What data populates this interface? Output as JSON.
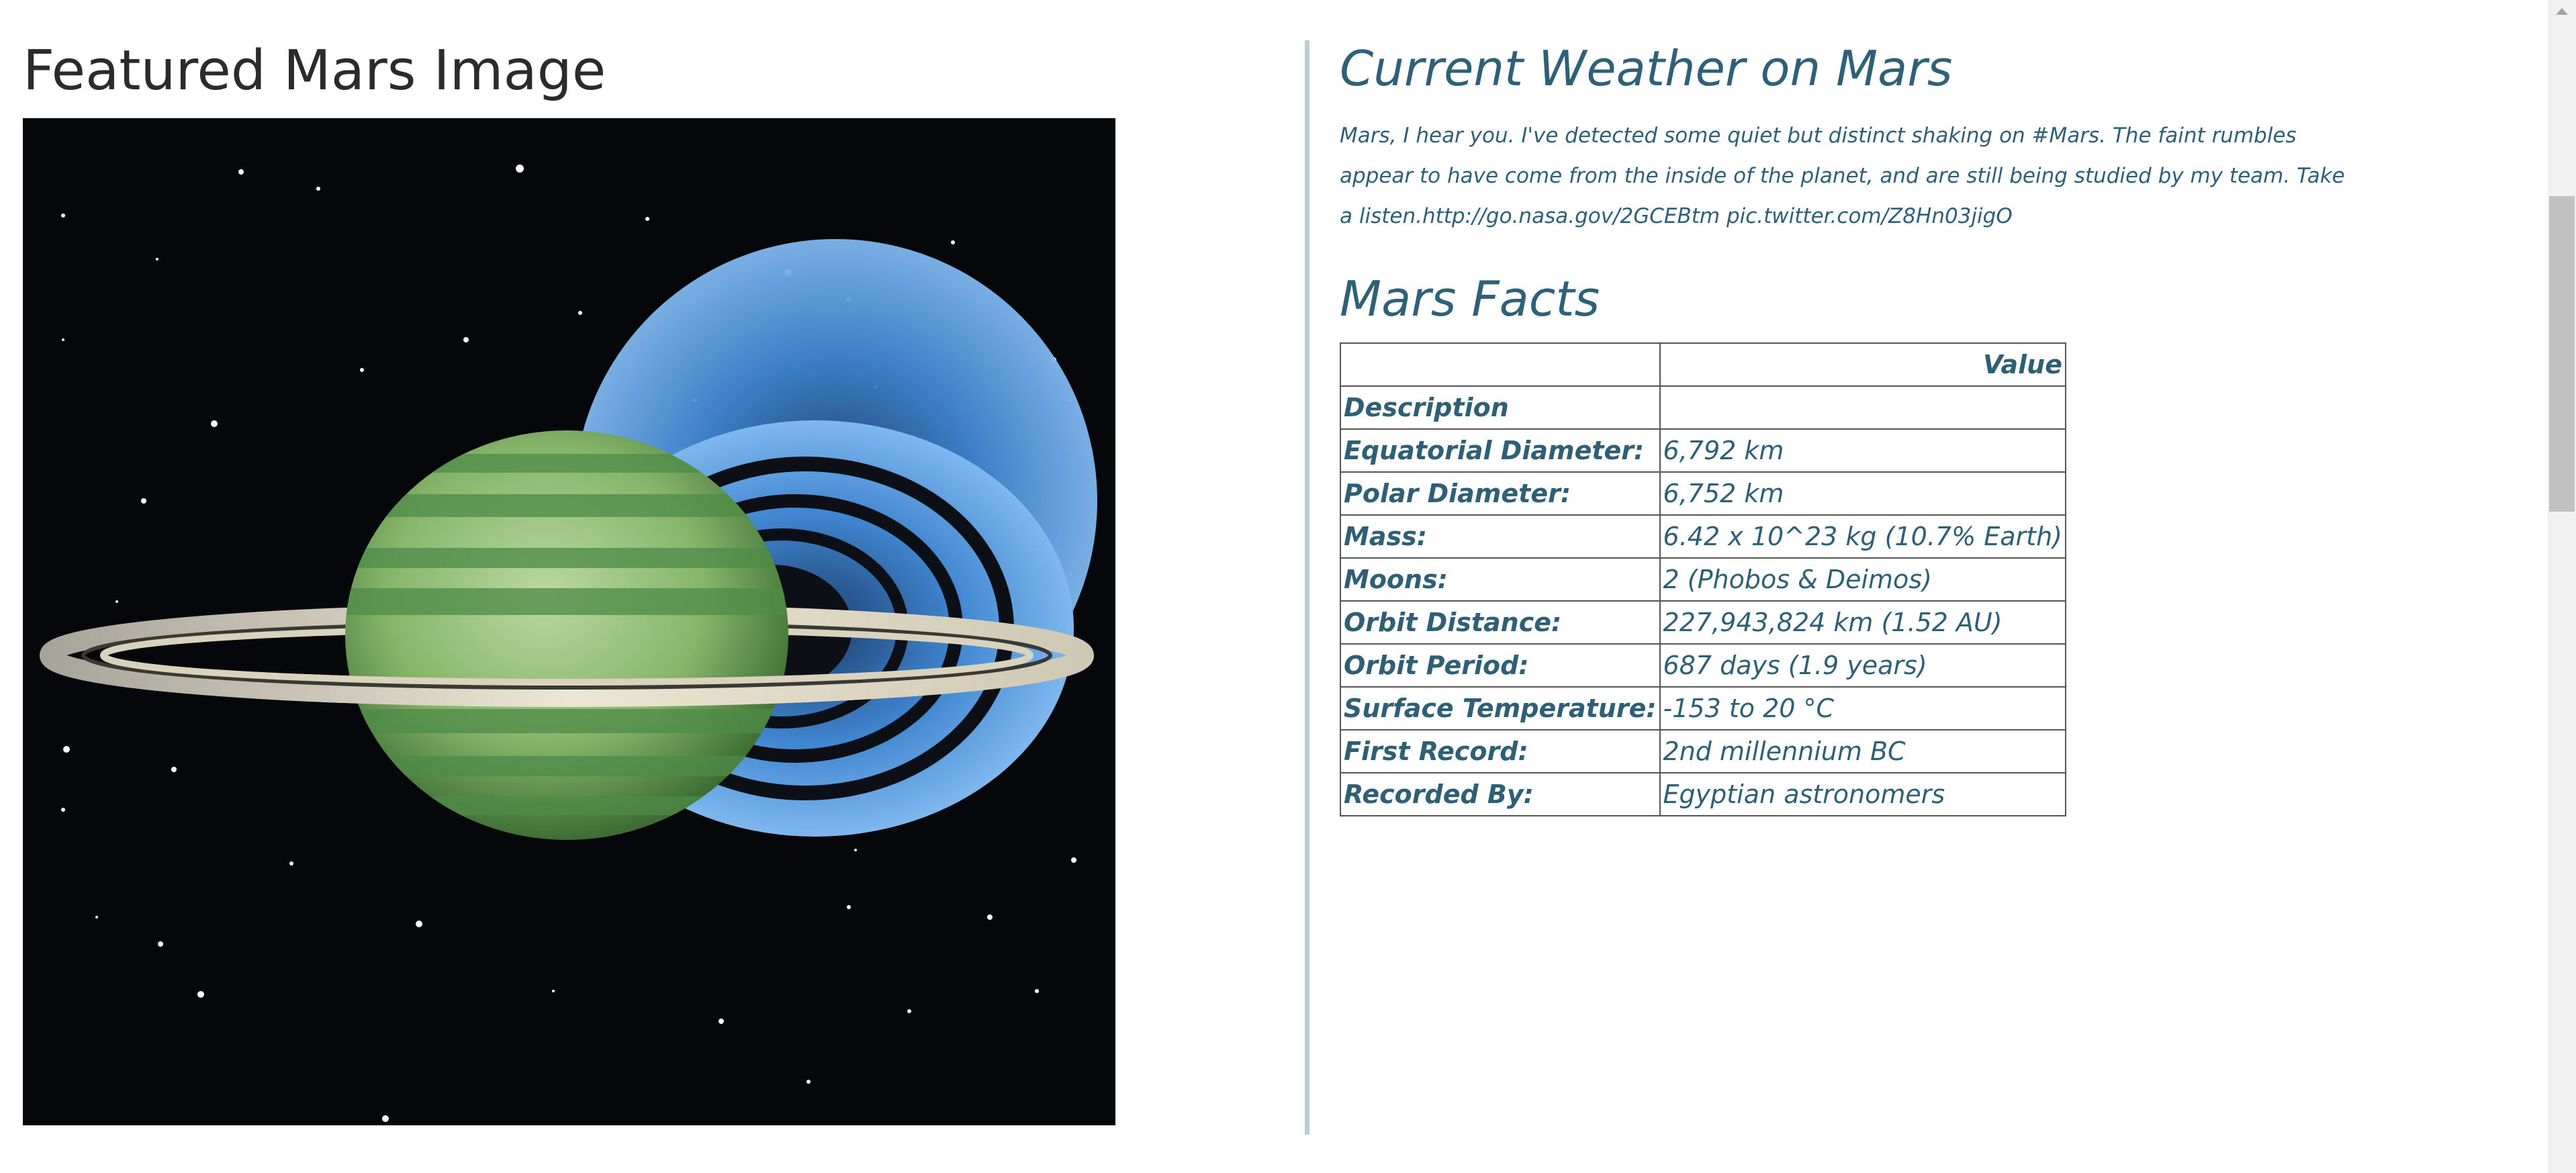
{
  "featured": {
    "title": "Featured Mars Image",
    "image_alt": "Ringed planet with green bands and blue rings on starry background"
  },
  "weather": {
    "title": "Current Weather on Mars",
    "text": "Mars, I hear you. I've detected some quiet but distinct shaking on #Mars. The faint rumbles appear to have come from the inside of the planet, and are still being studied by my team. Take a listen.http://go.nasa.gov/2GCEBtm pic.twitter.com/Z8Hn03jigO"
  },
  "facts": {
    "title": "Mars Facts",
    "header": {
      "label": "",
      "value": "Value"
    },
    "rows": [
      {
        "label": "Description",
        "value": ""
      },
      {
        "label": "Equatorial Diameter:",
        "value": "6,792 km"
      },
      {
        "label": "Polar Diameter:",
        "value": "6,752 km"
      },
      {
        "label": "Mass:",
        "value": "6.42 x 10^23 kg (10.7% Earth)"
      },
      {
        "label": "Moons:",
        "value": "2 (Phobos & Deimos)"
      },
      {
        "label": "Orbit Distance:",
        "value": "227,943,824 km (1.52 AU)"
      },
      {
        "label": "Orbit Period:",
        "value": "687 days (1.9 years)"
      },
      {
        "label": "Surface Temperature:",
        "value": "-153 to 20 °C"
      },
      {
        "label": "First Record:",
        "value": "2nd millennium BC"
      },
      {
        "label": "Recorded By:",
        "value": "Egyptian astronomers"
      }
    ]
  },
  "colors": {
    "heading": "#2e6078",
    "text": "#2e5f75",
    "divider": "#b9cdd4",
    "image_bg": "#05070a"
  }
}
